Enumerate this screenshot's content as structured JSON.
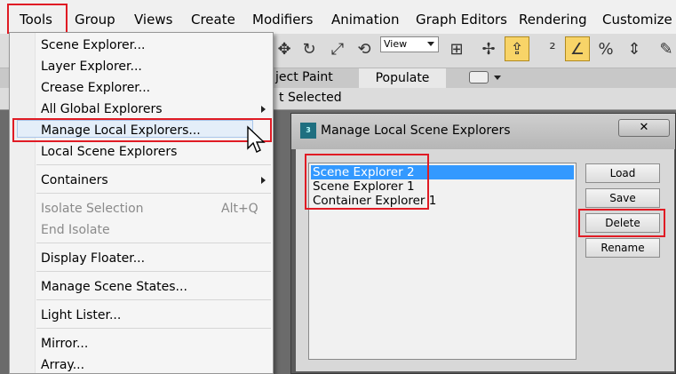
{
  "menubar": {
    "items": [
      "Tools",
      "Group",
      "Views",
      "Create",
      "Modifiers",
      "Animation",
      "Graph Editors",
      "Rendering",
      "Customize"
    ]
  },
  "toolbar": {
    "view_dropdown": "View",
    "tabs": [
      "ject Paint",
      "Populate"
    ],
    "selection_text": "t Selected"
  },
  "tools_menu": {
    "items": [
      {
        "label": "Scene Explorer..."
      },
      {
        "label": "Layer Explorer..."
      },
      {
        "label": "Crease Explorer..."
      },
      {
        "label": "All Global Explorers"
      },
      {
        "label": "Manage Local Explorers..."
      },
      {
        "label": "Local Scene Explorers"
      },
      {
        "label": "Containers"
      },
      {
        "label": "Isolate Selection",
        "shortcut": "Alt+Q"
      },
      {
        "label": "End Isolate"
      },
      {
        "label": "Display Floater..."
      },
      {
        "label": "Manage Scene States..."
      },
      {
        "label": "Light Lister..."
      },
      {
        "label": "Mirror..."
      },
      {
        "label": "Array..."
      }
    ]
  },
  "dialog": {
    "title": "Manage Local Scene Explorers",
    "close_label": "✕",
    "list": [
      "Scene Explorer 2",
      "Scene Explorer 1",
      "Container Explorer 1"
    ],
    "selected_index": 0,
    "buttons": {
      "load": "Load",
      "save": "Save",
      "delete": "Delete",
      "rename": "Rename"
    }
  },
  "colors": {
    "highlight": "#e01b24",
    "selection": "#3399ff"
  }
}
